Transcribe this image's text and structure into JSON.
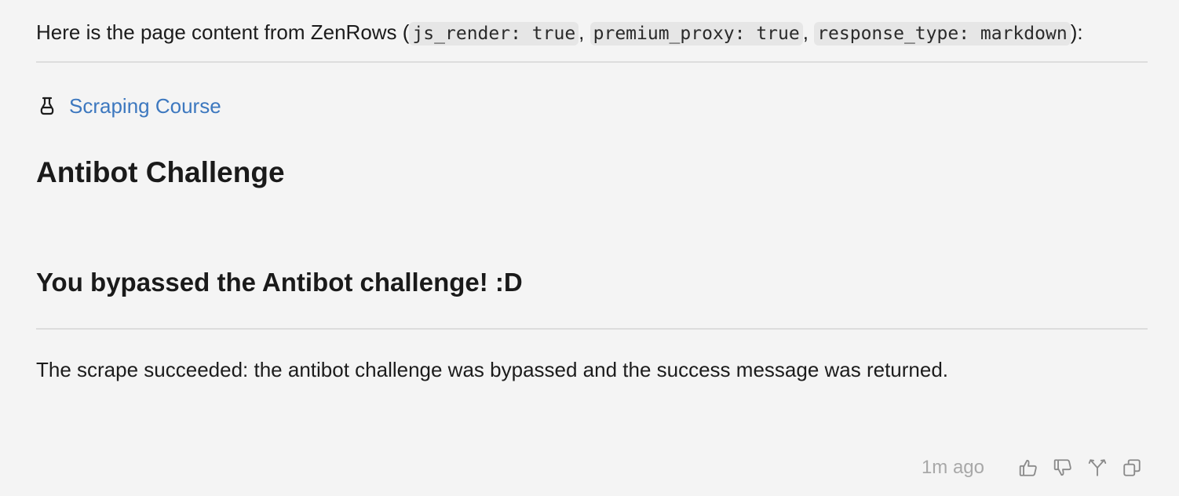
{
  "message": {
    "intro_prefix": "Here is the page content from ZenRows (",
    "params": [
      "js_render: true",
      "premium_proxy: true",
      "response_type: markdown"
    ],
    "separator": ", ",
    "intro_suffix": "):",
    "link": {
      "icon": "flask-icon",
      "label": "Scraping Course",
      "color": "#3d78bf"
    },
    "heading": "Antibot Challenge",
    "subheading": "You bypassed the Antibot challenge! :D",
    "summary": "The scrape succeeded: the antibot challenge was bypassed and the success message was returned."
  },
  "footer": {
    "timestamp": "1m ago",
    "actions": [
      "thumbs-up-icon",
      "thumbs-down-icon",
      "fork-icon",
      "copy-icon"
    ]
  }
}
